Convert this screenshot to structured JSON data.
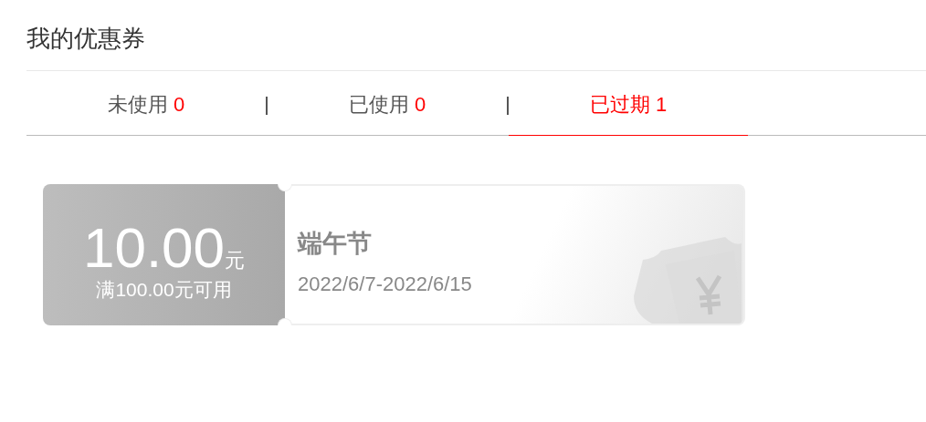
{
  "title": "我的优惠券",
  "tabs": [
    {
      "label": "未使用",
      "count": "0",
      "selected": false
    },
    {
      "label": "已使用",
      "count": "0",
      "selected": false
    },
    {
      "label": "已过期",
      "count": "1",
      "selected": true
    }
  ],
  "coupons": [
    {
      "amount": "10.00",
      "unit": "元",
      "condition": "满100.00元可用",
      "name": "端午节",
      "period": "2022/6/7-2022/6/15",
      "expired": true
    }
  ]
}
